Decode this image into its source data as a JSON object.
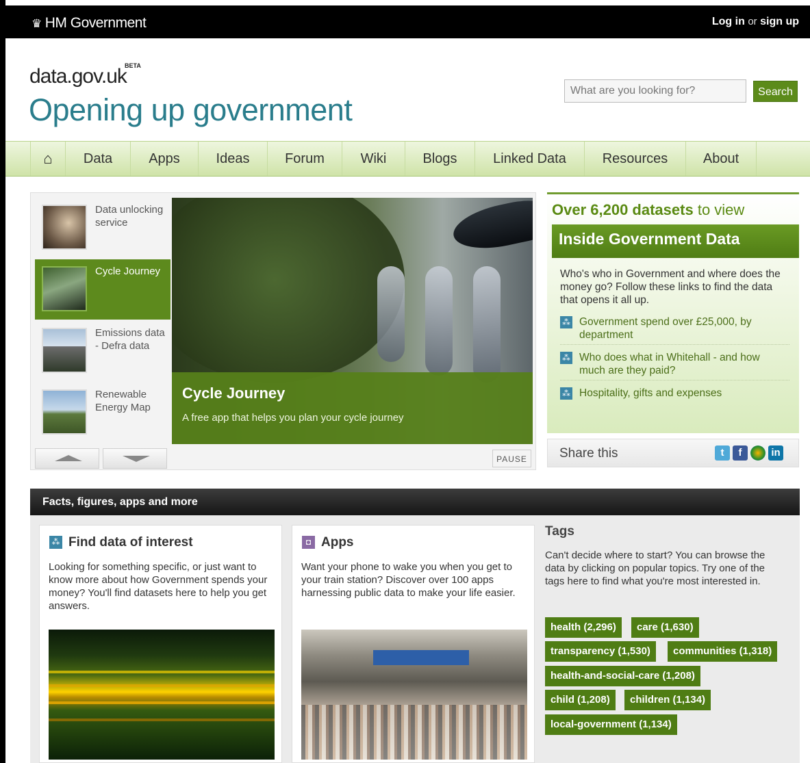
{
  "topbar": {
    "brand": "HM Government",
    "login_text": "Log in",
    "or_text": "or",
    "signup_text": "sign up"
  },
  "header": {
    "site_name": "data.gov.uk",
    "beta_label": "BETA",
    "tagline": "Opening up government"
  },
  "search": {
    "placeholder": "What are you looking for?",
    "button_label": "Search"
  },
  "nav": {
    "items": [
      "Data",
      "Apps",
      "Ideas",
      "Forum",
      "Wiki",
      "Blogs",
      "Linked Data",
      "Resources",
      "About"
    ]
  },
  "carousel": {
    "thumbs": [
      "Data unlocking service",
      "Cycle Journey",
      "Emissions data - Defra data",
      "Renewable Energy Map"
    ],
    "active_index": 1,
    "caption_title": "Cycle Journey",
    "caption_text": "A free app that helps you plan your cycle journey",
    "pause_label": "PAUSE"
  },
  "promo": {
    "count_text": "Over 6,200 datasets",
    "count_suffix": "to view",
    "band_title": "Inside Government Data",
    "intro": "Who's who in Government and where does the money go? Follow these links to find the data that opens it all up.",
    "links": [
      "Government spend over £25,000, by department",
      "Who does what in Whitehall - and how much are they paid?",
      "Hospitality, gifts and expenses"
    ],
    "share_label": "Share this"
  },
  "facts": {
    "bar_title": "Facts, figures, apps and more",
    "find": {
      "title": "Find data of interest",
      "text": "Looking for something specific, or just want to know more about how Government spends your money? You'll find datasets here to help you get answers."
    },
    "apps": {
      "title": "Apps",
      "text": "Want your phone to wake you when you get to your train station? Discover over 100 apps harnessing public data to make your life easier."
    },
    "tags": {
      "title": "Tags",
      "text": "Can't decide where to start? You can browse the data by clicking on popular topics. Try one of the tags here to find what you're most interested in.",
      "items": [
        "health (2,296)",
        "care (1,630)",
        "transparency (1,530)",
        "communities (1,318)",
        "health-and-social-care (1,208)",
        "child (1,208)",
        "children (1,134)",
        "local-government (1,134)"
      ]
    }
  },
  "colors": {
    "brand_green": "#5c8b1a",
    "teal": "#2a7d8c",
    "tag_green": "#4f7d14"
  }
}
